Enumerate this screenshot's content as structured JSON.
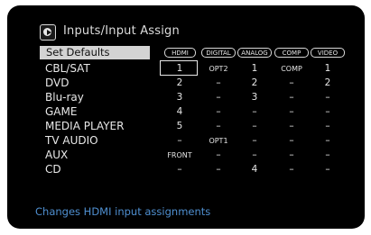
{
  "header": {
    "title": "Inputs/Input Assign",
    "icon": "input-source-icon"
  },
  "set_defaults": "Set Defaults",
  "columns": [
    "HDMI",
    "DIGITAL",
    "ANALOG",
    "COMP",
    "VIDEO"
  ],
  "rows": [
    {
      "label": "CBL/SAT",
      "cells": [
        "1",
        "OPT2",
        "1",
        "COMP",
        "1"
      ]
    },
    {
      "label": "DVD",
      "cells": [
        "2",
        "–",
        "2",
        "–",
        "2"
      ]
    },
    {
      "label": "Blu-ray",
      "cells": [
        "3",
        "–",
        "3",
        "–",
        "–"
      ]
    },
    {
      "label": "GAME",
      "cells": [
        "4",
        "–",
        "–",
        "–",
        "–"
      ]
    },
    {
      "label": "MEDIA PLAYER",
      "cells": [
        "5",
        "–",
        "–",
        "–",
        "–"
      ]
    },
    {
      "label": "TV AUDIO",
      "cells": [
        "–",
        "OPT1",
        "–",
        "–",
        "–"
      ]
    },
    {
      "label": "AUX",
      "cells": [
        "FRONT",
        "–",
        "–",
        "–",
        "–"
      ]
    },
    {
      "label": "CD",
      "cells": [
        "–",
        "–",
        "4",
        "–",
        "–"
      ]
    }
  ],
  "help_text": "Changes HDMI input assignments",
  "colors": {
    "background": "#000000",
    "text": "#e6e6e6",
    "help": "#4f8fd0",
    "selected_bar": "#d3d3d3"
  }
}
